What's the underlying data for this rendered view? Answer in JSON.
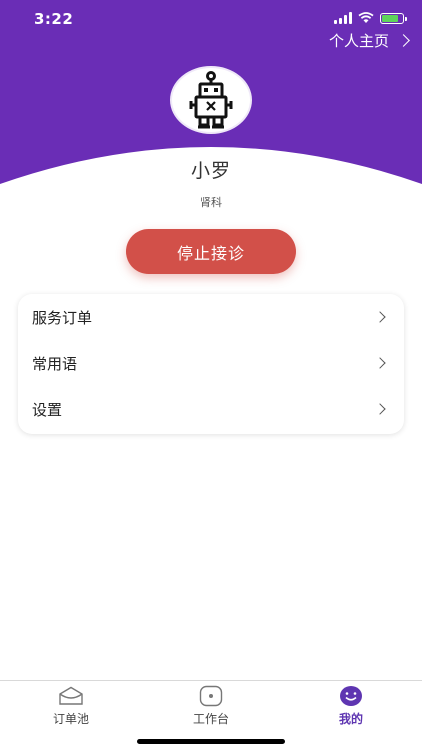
{
  "status_bar": {
    "time": "3:22"
  },
  "colors": {
    "header_purple": "#6a2db6",
    "stop_button": "#d25049",
    "active_tab": "#5e35b1"
  },
  "header": {
    "profile_link": "个人主页",
    "avatar_icon": "robot-icon"
  },
  "profile": {
    "name": "小罗",
    "department": "肾科"
  },
  "actions": {
    "stop_consultation": "停止接诊"
  },
  "menu": {
    "items": [
      {
        "label": "服务订单",
        "icon": "chevron-right-icon"
      },
      {
        "label": "常用语",
        "icon": "chevron-right-icon"
      },
      {
        "label": "设置",
        "icon": "chevron-right-icon"
      }
    ]
  },
  "tabbar": {
    "tabs": [
      {
        "label": "订单池",
        "icon": "envelope-icon",
        "active": false
      },
      {
        "label": "工作台",
        "icon": "workbench-icon",
        "active": false
      },
      {
        "label": "我的",
        "icon": "smiley-icon",
        "active": true
      }
    ]
  }
}
